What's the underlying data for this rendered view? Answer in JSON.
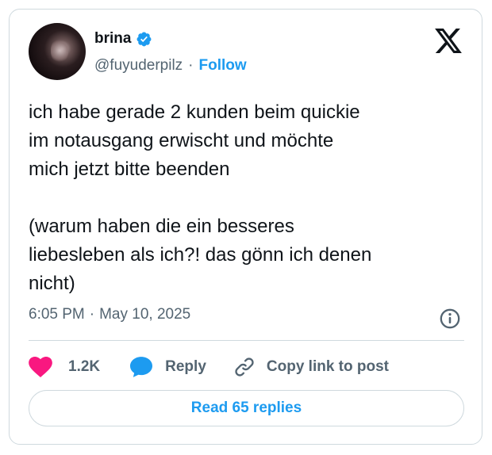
{
  "author": {
    "name": "brina",
    "handle": "@fuyuderpilz",
    "separator": "·",
    "follow_label": "Follow"
  },
  "tweet": {
    "text": "ich habe gerade 2 kunden beim quickie\nim notausgang erwischt und möchte\nmich jetzt bitte beenden\n\n(warum haben die ein besseres\nliebesleben als ich?! das gönn ich denen\nnicht)",
    "time": "6:05 PM",
    "date_separator": "·",
    "date": "May 10, 2025"
  },
  "actions": {
    "like_count": "1.2K",
    "reply_label": "Reply",
    "copy_label": "Copy link to post"
  },
  "read_replies_label": "Read 65 replies",
  "icons": {
    "platform": "x-logo-icon",
    "verified": "verified-badge-icon",
    "info": "info-icon",
    "like": "heart-icon",
    "reply": "speech-bubble-icon",
    "copy": "link-icon"
  },
  "colors": {
    "accent": "#1d9bf0",
    "like": "#f91880",
    "text": "#0f1419",
    "secondary_text": "#536471",
    "border": "#cfd9de"
  }
}
